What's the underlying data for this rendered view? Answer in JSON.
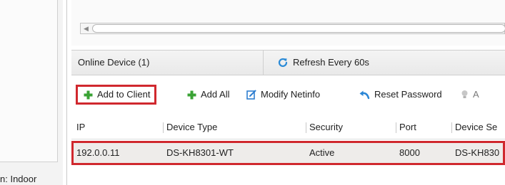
{
  "left_panel": {
    "label_text": "n: Indoor"
  },
  "tabs": {
    "online_device": "Online Device (1)",
    "refresh": "Refresh Every 60s"
  },
  "toolbar": {
    "add_to_client": "Add to Client",
    "add_all": "Add All",
    "modify_netinfo": "Modify Netinfo",
    "reset_password": "Reset Password",
    "truncated": "A"
  },
  "table": {
    "columns": [
      "IP",
      "Device Type",
      "Security",
      "Port",
      "Device Se"
    ],
    "rows": [
      {
        "ip": "192.0.0.11",
        "device_type": "DS-KH8301-WT",
        "security": "Active",
        "port": "8000",
        "device_serial": "DS-KH830"
      }
    ]
  },
  "colors": {
    "highlight_border": "#d0282e",
    "add_icon": "#3aa335",
    "modify_icon": "#2f7fd0",
    "reset_icon": "#2a86d6",
    "selected_row": "#eeecea"
  },
  "icons": {
    "refresh": "refresh-icon",
    "add_to_client": "plus-icon",
    "add_all": "plus-icon",
    "modify_netinfo": "edit-icon",
    "reset_password": "undo-icon",
    "more": "bulb-icon"
  }
}
